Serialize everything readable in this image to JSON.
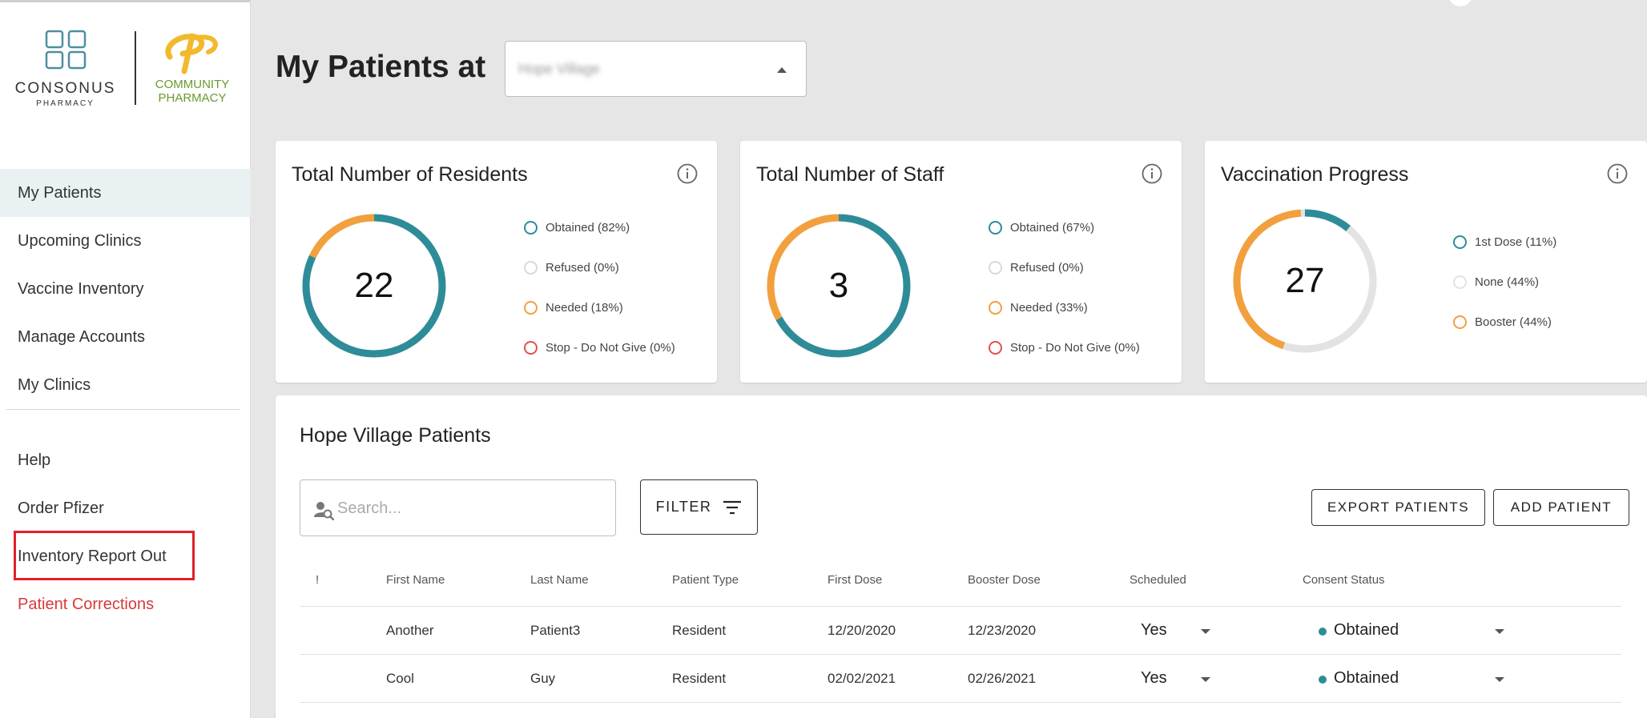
{
  "brand": {
    "consonus_name": "CONSONUS",
    "consonus_sub": "PHARMACY",
    "community_name_line1": "COMMUNITY",
    "community_name_line2": "PHARMACY",
    "colors": {
      "teal": "#2e8c99",
      "orange": "#f2a03d",
      "green": "#6a9a2c",
      "red": "#d63a3a"
    }
  },
  "sidebar": {
    "items": [
      {
        "label": "My Patients",
        "active": true
      },
      {
        "label": "Upcoming Clinics"
      },
      {
        "label": "Vaccine Inventory"
      },
      {
        "label": "Manage Accounts"
      },
      {
        "label": "My Clinics"
      }
    ],
    "secondary": [
      {
        "label": "Help"
      },
      {
        "label": "Order Pfizer"
      },
      {
        "label": "Inventory Report Out",
        "highlighted": true
      },
      {
        "label": "Patient Corrections",
        "color": "red"
      }
    ]
  },
  "header": {
    "title": "My Patients at",
    "facility_value": "Hope Village"
  },
  "cards": [
    {
      "title": "Total Number of Residents",
      "total": "22",
      "legend": [
        {
          "label": "Obtained (82%)",
          "color": "#2e8c99",
          "pct": 82
        },
        {
          "label": "Refused (0%)",
          "color": "#d9d9d9",
          "pct": 0
        },
        {
          "label": "Needed (18%)",
          "color": "#f2a03d",
          "pct": 18
        },
        {
          "label": "Stop - Do Not Give (0%)",
          "color": "#e05050",
          "pct": 0
        }
      ]
    },
    {
      "title": "Total Number of Staff",
      "total": "3",
      "legend": [
        {
          "label": "Obtained (67%)",
          "color": "#2e8c99",
          "pct": 67
        },
        {
          "label": "Refused (0%)",
          "color": "#d9d9d9",
          "pct": 0
        },
        {
          "label": "Needed (33%)",
          "color": "#f2a03d",
          "pct": 33
        },
        {
          "label": "Stop - Do Not Give (0%)",
          "color": "#e05050",
          "pct": 0
        }
      ]
    },
    {
      "title": "Vaccination Progress",
      "total": "27",
      "legend": [
        {
          "label": "1st Dose (11%)",
          "color": "#2e8c99",
          "pct": 11
        },
        {
          "label": "None (44%)",
          "color": "#e3e3e3",
          "pct": 44
        },
        {
          "label": "Booster (44%)",
          "color": "#f2a03d",
          "pct": 44
        }
      ]
    }
  ],
  "patients": {
    "title": "Hope Village Patients",
    "search_placeholder": "Search...",
    "filter_label": "FILTER",
    "export_label": "EXPORT PATIENTS",
    "add_label": "ADD PATIENT",
    "columns": [
      "!",
      "First Name",
      "Last Name",
      "Patient Type",
      "First Dose",
      "Booster Dose",
      "Scheduled",
      "Consent Status"
    ],
    "rows": [
      {
        "first": "Another",
        "last": "Patient3",
        "type": "Resident",
        "first_dose": "12/20/2020",
        "booster": "12/23/2020",
        "scheduled": "Yes",
        "consent": "Obtained"
      },
      {
        "first": "Cool",
        "last": "Guy",
        "type": "Resident",
        "first_dose": "02/02/2021",
        "booster": "02/26/2021",
        "scheduled": "Yes",
        "consent": "Obtained"
      }
    ]
  }
}
